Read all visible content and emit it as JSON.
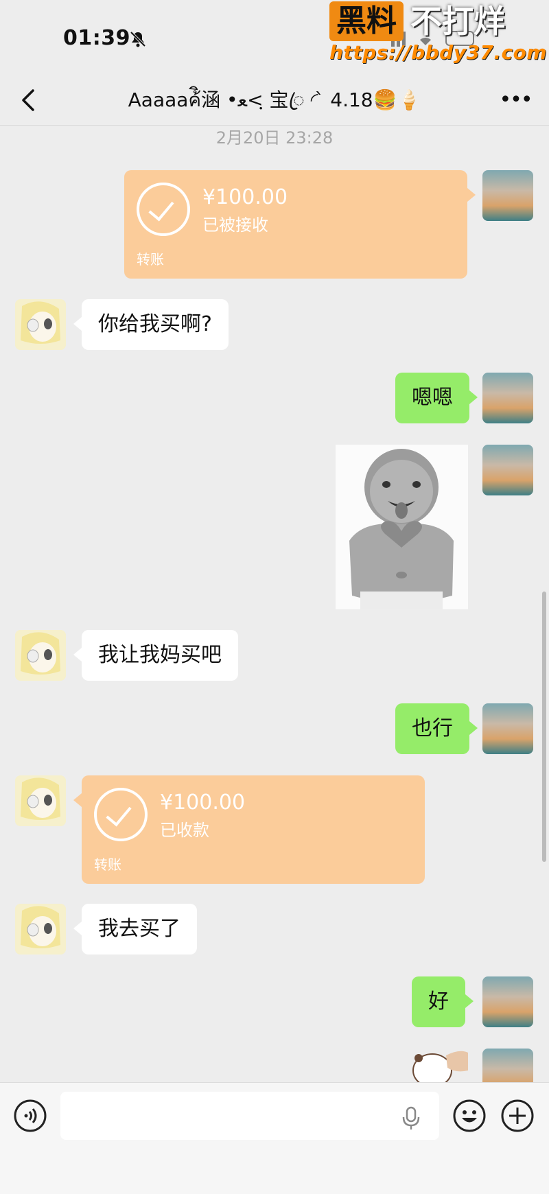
{
  "status_bar": {
    "time": "01:39",
    "mute_icon": "bell-slash-icon"
  },
  "watermark": {
    "badge": "黑料",
    "text": "不打烊",
    "url": "https://bbdy37.com"
  },
  "header": {
    "title": "Aaaaaค้ิ涵 •ﻌ<ฺ 宝ꦿ ◜ ̀ 4.18🍔🍦",
    "back_icon": "chevron-left-icon",
    "more_icon": "more-icon"
  },
  "timestamp": "2月20日 23:28",
  "messages": [
    {
      "from": "me",
      "type": "transfer",
      "amount": "¥100.00",
      "status": "已被接收",
      "label": "转账"
    },
    {
      "from": "other",
      "type": "text",
      "text": "你给我买啊?"
    },
    {
      "from": "me",
      "type": "text",
      "text": "嗯嗯"
    },
    {
      "from": "me",
      "type": "sticker",
      "caption": ""
    },
    {
      "from": "other",
      "type": "text",
      "text": "我让我妈买吧"
    },
    {
      "from": "me",
      "type": "text",
      "text": "也行"
    },
    {
      "from": "other",
      "type": "transfer",
      "amount": "¥100.00",
      "status": "已收款",
      "label": "转账"
    },
    {
      "from": "other",
      "type": "text",
      "text": "我去买了"
    },
    {
      "from": "me",
      "type": "text",
      "text": "好"
    },
    {
      "from": "me",
      "type": "sticker",
      "caption": ""
    }
  ],
  "input_bar": {
    "placeholder": "",
    "voice_icon": "voice-icon",
    "mic_icon": "microphone-icon",
    "emoji_icon": "emoji-icon",
    "plus_icon": "plus-icon"
  },
  "colors": {
    "background": "#ededed",
    "my_bubble": "#95ec69",
    "their_bubble": "#ffffff",
    "transfer": "#fbcc9a"
  }
}
